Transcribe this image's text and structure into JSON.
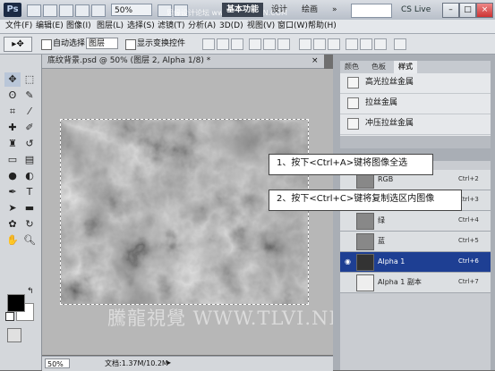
{
  "app": {
    "logo": "Ps",
    "zoom": "50%",
    "workspaces": {
      "basic": "基本功能",
      "design": "设计",
      "paint": "绘画",
      "more": "»"
    },
    "cs_live": "CS Live",
    "site_watermark": "思缘设计论坛 www.MISSYUAN.COM",
    "window_buttons": {
      "minimize": "–",
      "restore": "□",
      "close": "×"
    }
  },
  "menu": [
    "文件(F)",
    "编辑(E)",
    "图像(I)",
    "图层(L)",
    "选择(S)",
    "滤镜(T)",
    "分析(A)",
    "3D(D)",
    "视图(V)",
    "窗口(W)",
    "帮助(H)"
  ],
  "options": {
    "auto_select_label": "自动选择:",
    "auto_select_value": "图层",
    "transform_label": "显示变换控件"
  },
  "document": {
    "tab_title": "底纹背景.psd @ 50% (图层 2, Alpha 1/8) *",
    "zoom": "50%",
    "doc_size": "文档:1.37M/10.2M"
  },
  "panels": {
    "tabs": [
      "颜色",
      "色板",
      "样式"
    ],
    "active_tab": "样式",
    "styles": [
      "高光拉丝金属",
      "拉丝金属",
      "冲压拉丝金属"
    ]
  },
  "channels": [
    {
      "name": "RGB",
      "shortcut": "Ctrl+2",
      "visible": false,
      "selected": false
    },
    {
      "name": "红",
      "shortcut": "Ctrl+3",
      "visible": false,
      "selected": false
    },
    {
      "name": "绿",
      "shortcut": "Ctrl+4",
      "visible": false,
      "selected": false
    },
    {
      "name": "蓝",
      "shortcut": "Ctrl+5",
      "visible": false,
      "selected": false
    },
    {
      "name": "Alpha 1",
      "shortcut": "Ctrl+6",
      "visible": true,
      "selected": true
    },
    {
      "name": "Alpha 1 副本",
      "shortcut": "Ctrl+7",
      "visible": false,
      "selected": false
    }
  ],
  "callouts": [
    "1、按下<Ctrl+A>键将图像全选",
    "2、按下<Ctrl+C>键将复制选区内图像"
  ],
  "watermark": "騰龍視覺 WWW.TLVI.NET",
  "colors": {
    "selection": "#1e3f93",
    "foreground": "#000000",
    "background": "#ffffff"
  }
}
